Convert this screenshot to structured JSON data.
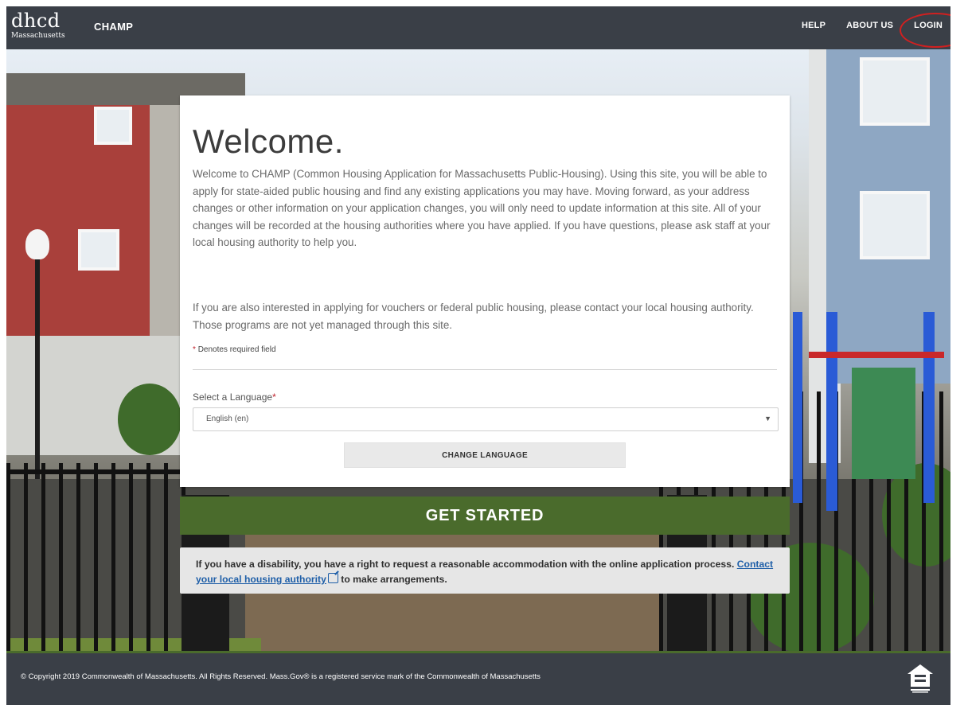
{
  "header": {
    "logo_text": "dhcd",
    "logo_subtext": "Massachusetts",
    "app_name": "CHAMP",
    "nav": [
      "HELP",
      "ABOUT US",
      "LOGIN"
    ]
  },
  "welcome": {
    "title": "Welcome.",
    "intro": "Welcome to CHAMP (Common Housing Application for Massachusetts Public-Housing). Using this site, you will be able to apply for state-aided public housing and find any existing applications you may have. Moving forward, as your address changes or other information on your application changes, you will only need to update information at this site. All of your changes will be recorded at the housing authorities where you have applied. If you have questions, please ask staff at your local housing authority to help you.",
    "intro2": "If you are also interested in applying for vouchers or federal public housing, please contact your local housing authority. Those programs are not yet managed through this site.",
    "required_mark": "*",
    "required_note": "Denotes required field",
    "language_label": "Select a Language",
    "language_value": "English (en)",
    "change_language": "CHANGE LANGUAGE"
  },
  "cta": {
    "get_started": "GET STARTED"
  },
  "notice": {
    "text_before": "If you have a disability, you have a right to request a reasonable accommodation with the online application process. ",
    "link_text": "Contact your local housing authority",
    "text_after": " to make arrangements."
  },
  "footer": {
    "copyright": "© Copyright 2019 Commonwealth of Massachusetts. All Rights Reserved. Mass.Gov® is a registered service mark of the Commonwealth of Massachusetts"
  },
  "colors": {
    "header_bg": "#3a3f47",
    "primary_green": "#4a6b2c",
    "link_blue": "#1f5fa8",
    "required_red": "#c0202a",
    "annotation_red": "#d02020"
  },
  "icons": {
    "external_link": "external-link-icon",
    "equal_housing": "equal-housing-opportunity-icon",
    "select_caret": "chevron-down-icon"
  }
}
